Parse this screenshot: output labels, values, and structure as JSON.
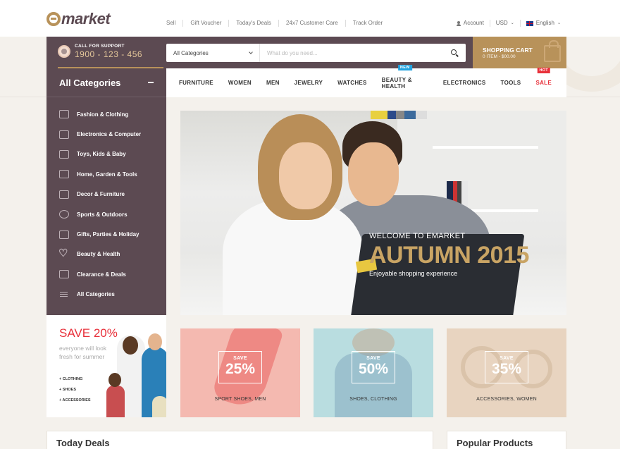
{
  "brand": {
    "logo_text": "market"
  },
  "top_links": [
    "Sell",
    "Gift Voucher",
    "Today's Deals",
    "24x7 Customer Care",
    "Track Order"
  ],
  "top_right": {
    "account": "Account",
    "currency": "USD",
    "language": "English"
  },
  "support": {
    "label": "CALL FOR SUPPORT",
    "phone": "1900 - 123 - 456"
  },
  "search": {
    "category": "All Categories",
    "placeholder": "What do you need..."
  },
  "cart": {
    "title": "SHOPPING CART",
    "info": "0 ITEM - $00.00"
  },
  "sidebar": {
    "title": "All Categories",
    "items": [
      {
        "label": "Fashion & Clothing",
        "icon": "shirt-icon"
      },
      {
        "label": "Electronics & Computer",
        "icon": "computer-icon"
      },
      {
        "label": "Toys, Kids & Baby",
        "icon": "toy-icon"
      },
      {
        "label": "Home, Garden & Tools",
        "icon": "tools-icon"
      },
      {
        "label": "Decor & Furniture",
        "icon": "sofa-icon"
      },
      {
        "label": "Sports & Outdoors",
        "icon": "ball-icon"
      },
      {
        "label": "Gifts, Parties & Holiday",
        "icon": "gift-icon"
      },
      {
        "label": "Beauty & Health",
        "icon": "heart-icon"
      },
      {
        "label": "Clearance & Deals",
        "icon": "tag-icon"
      },
      {
        "label": "All Categories",
        "icon": "menu-icon"
      }
    ]
  },
  "nav": {
    "items": [
      "FURNITURE",
      "WOMEN",
      "MEN",
      "JEWELRY",
      "WATCHES",
      "BEAUTY & HEALTH",
      "ELECTRONICS",
      "TOOLS",
      "SALE"
    ],
    "badge_new": "NEW",
    "badge_hot": "HOT"
  },
  "hero": {
    "subtitle": "WELCOME TO EMARKET",
    "title": "AUTUMN 2015",
    "tagline": "Enjoyable shopping experience"
  },
  "promo": {
    "title": "SAVE 20%",
    "subtitle": "everyone will look fresh for summer",
    "list": [
      "+ CLOTHING",
      "+ SHOES",
      "+ ACCESSORIES"
    ]
  },
  "banners": [
    {
      "save": "SAVE",
      "percent": "25%",
      "caption": "SPORT SHOES, MEN",
      "color": "#f4b9b0"
    },
    {
      "save": "SAVE",
      "percent": "50%",
      "caption": "SHOES, CLOTHING",
      "color": "#b9dde0"
    },
    {
      "save": "SAVE",
      "percent": "35%",
      "caption": "ACCESSORIES, WOMEN",
      "color": "#e8d4c0"
    }
  ],
  "sections": {
    "today_deals": "Today Deals",
    "popular_products": "Popular Products"
  },
  "colors": {
    "primary": "#5c4a52",
    "accent": "#b8925a",
    "sale": "#e8303a"
  }
}
